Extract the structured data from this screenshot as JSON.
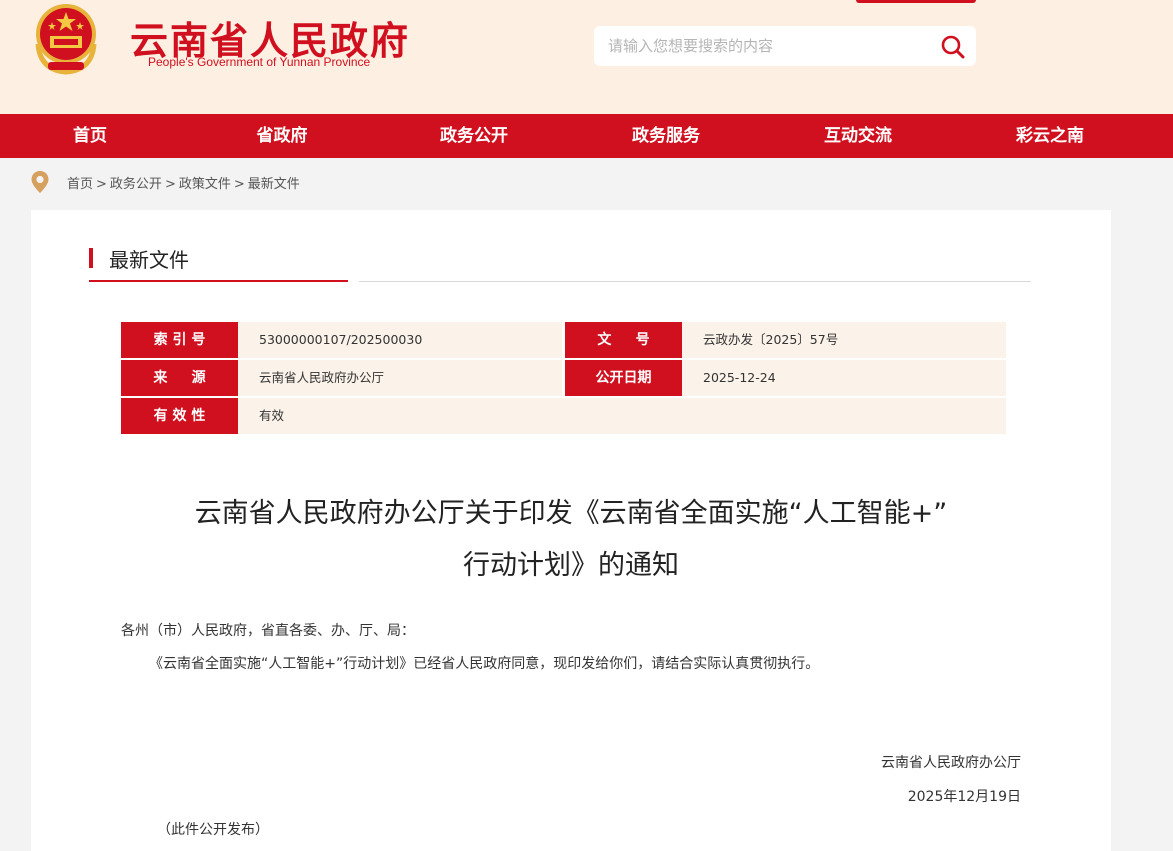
{
  "header": {
    "title": "云南省人民政府",
    "subtitle": "People's Government of Yunnan Province",
    "search_placeholder": "请输入您想要搜索的内容"
  },
  "nav": {
    "items": [
      "首页",
      "省政府",
      "政务公开",
      "政务服务",
      "互动交流",
      "彩云之南"
    ]
  },
  "breadcrumb": {
    "items": [
      "首页",
      "政务公开",
      "政策文件",
      "最新文件"
    ],
    "separator": ">"
  },
  "section": {
    "title": "最新文件"
  },
  "meta": {
    "index_label": "索 引 号",
    "index_value": "53000000107/202500030",
    "docno_label": "文     号",
    "docno_value": "云政办发〔2025〕57号",
    "source_label": "来     源",
    "source_value": "云南省人民政府办公厅",
    "pubdate_label": "公开日期",
    "pubdate_value": "2025-12-24",
    "validity_label": "有 效 性",
    "validity_value": "有效"
  },
  "document": {
    "title_line1": "云南省人民政府办公厅关于印发《云南省全面实施“人工智能+”",
    "title_line2": "行动计划》的通知",
    "salutation": "各州（市）人民政府，省直各委、办、厅、局：",
    "body": "《云南省全面实施“人工智能+”行动计划》已经省人民政府同意，现印发给你们，请结合实际认真贯彻执行。",
    "signer": "云南省人民政府办公厅",
    "date": "2025年12月19日",
    "note": "（此件公开发布）"
  },
  "colors": {
    "brand_red": "#d0101f",
    "header_bg": "#fdefe2",
    "meta_value_bg": "#fbf3ea",
    "page_bg": "#f3f3f3"
  },
  "icons": {
    "emblem": "national-emblem-icon",
    "search": "search-icon",
    "location": "location-pin-icon"
  }
}
